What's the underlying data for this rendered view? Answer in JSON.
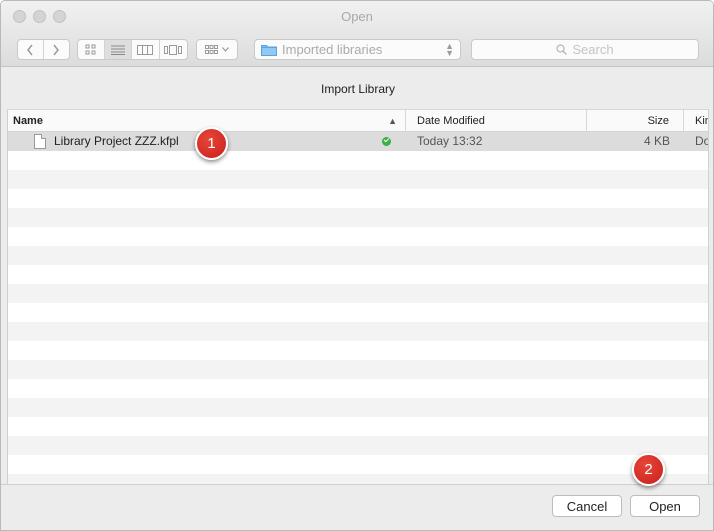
{
  "window": {
    "title": "Open"
  },
  "toolbar": {
    "path_popup": "Imported libraries",
    "search_placeholder": "Search"
  },
  "banner": {
    "title": "Import Library"
  },
  "columns": {
    "name": "Name",
    "date": "Date Modified",
    "size": "Size",
    "kind": "Kin"
  },
  "files": [
    {
      "name": "Library Project ZZZ.kfpl",
      "date": "Today 13:32",
      "size": "4 KB",
      "kind": "Do",
      "status": "check-icon"
    }
  ],
  "buttons": {
    "cancel": "Cancel",
    "open": "Open"
  },
  "annotations": {
    "badge1": "1",
    "badge2": "2"
  },
  "colors": {
    "badge": "#d2271e",
    "check": "#3cb043",
    "selected_row": "#dcdcdc"
  }
}
